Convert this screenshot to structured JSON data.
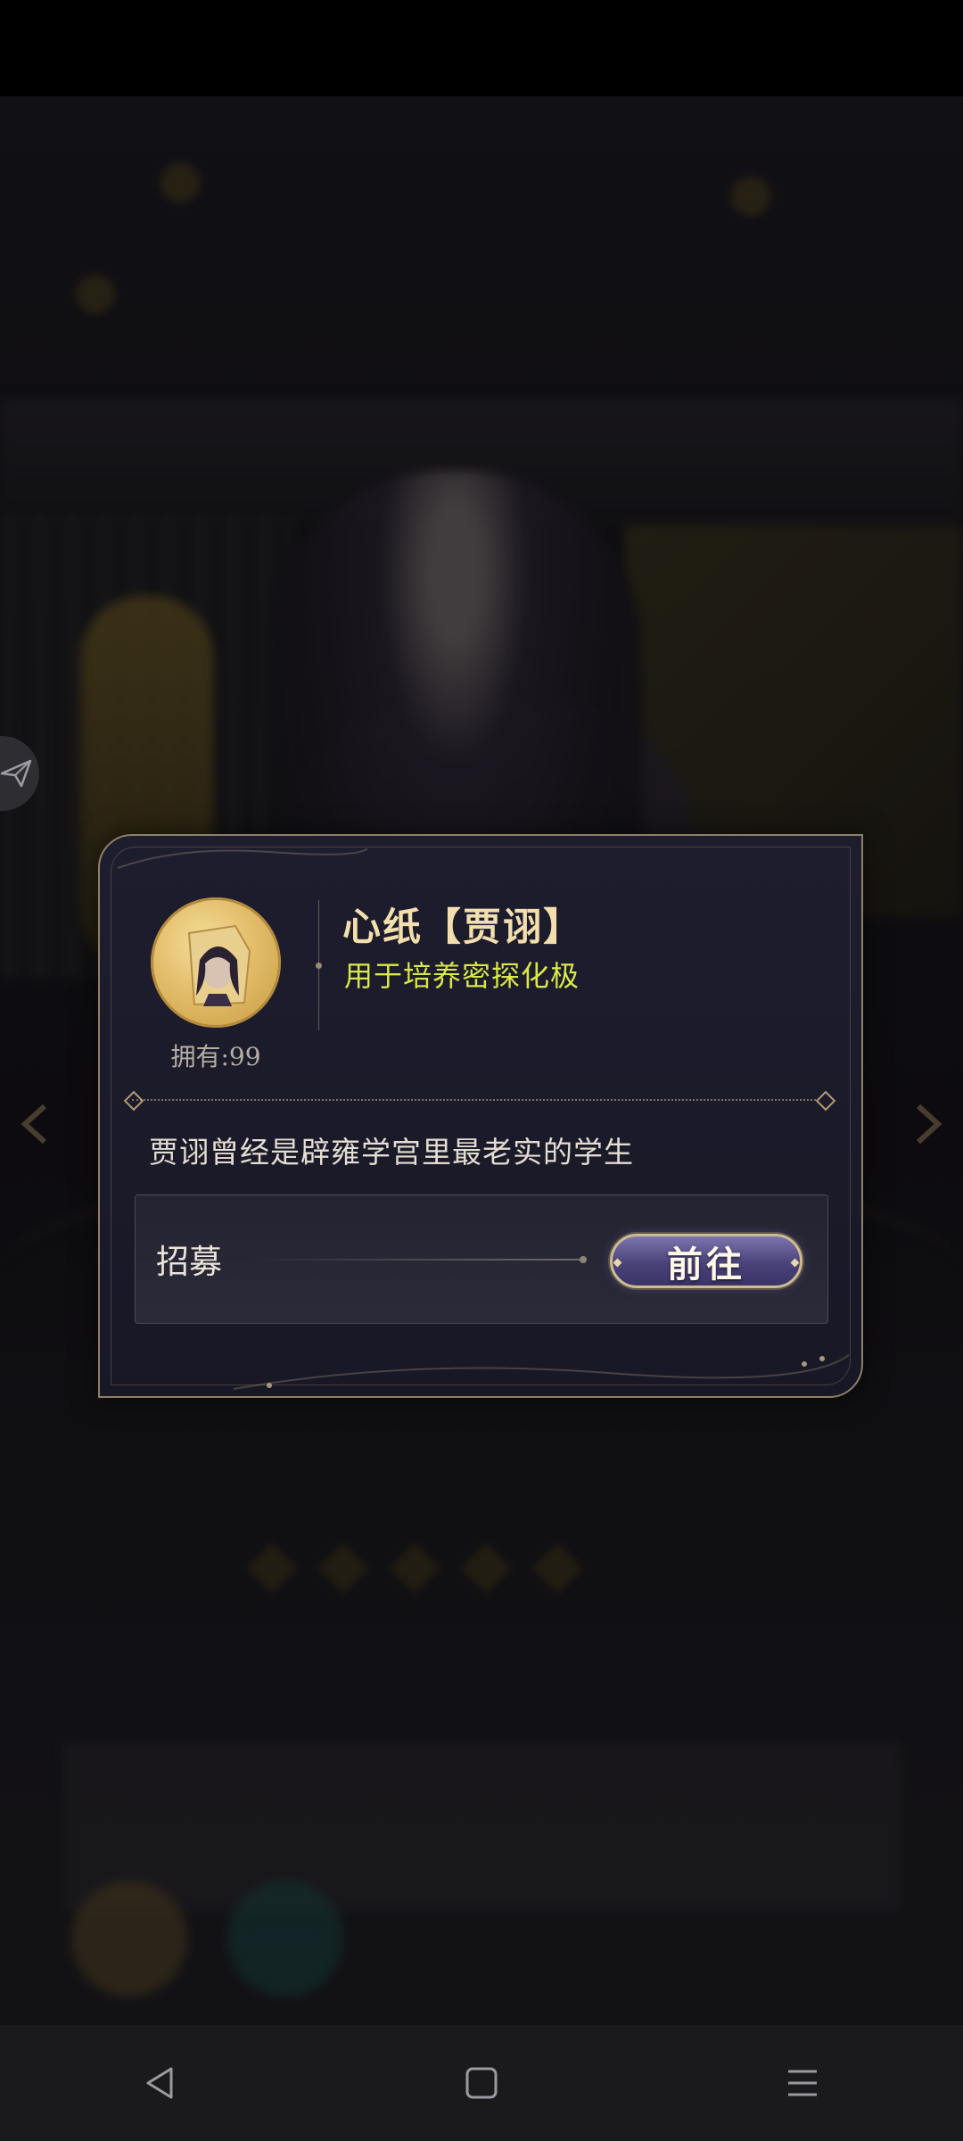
{
  "dialog": {
    "item_title": "心纸【贾诩】",
    "item_subtitle": "用于培养密探化极",
    "owned_label": "拥有:99",
    "description": "贾诩曾经是辟雍学宫里最老实的学生",
    "source": {
      "label": "招募",
      "goto_label": "前往"
    }
  },
  "colors": {
    "title_gold": "#f3dfad",
    "subtitle_green": "#d9e84a",
    "button_purple": "#4a437a",
    "frame_border": "#8e7f67"
  },
  "nav_bar": {
    "icons": [
      "back-triangle-icon",
      "home-square-icon",
      "menu-lines-icon"
    ]
  }
}
